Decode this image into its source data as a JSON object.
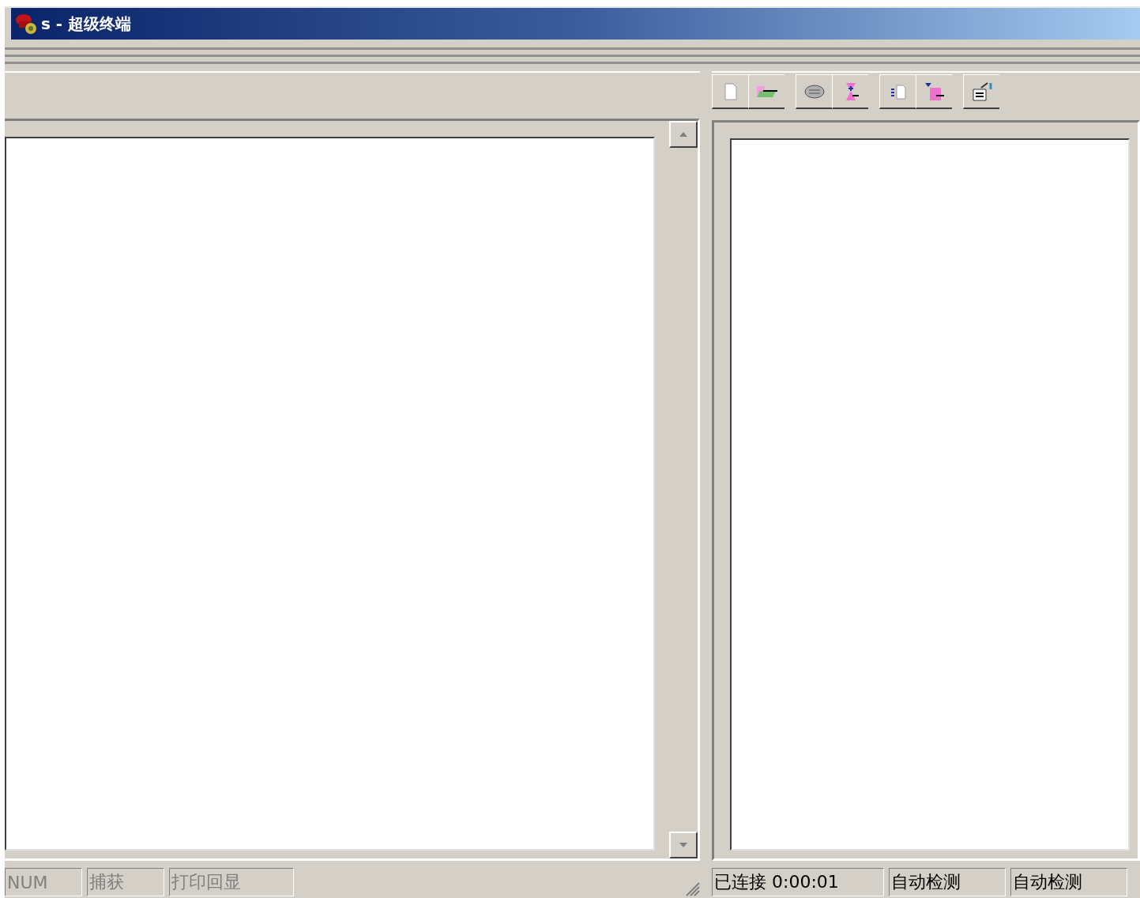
{
  "window": {
    "title": "s - 超级终端"
  },
  "left_status_bar": [
    {
      "text": "NUM",
      "disabled": true
    },
    {
      "text": "捕获",
      "disabled": true
    },
    {
      "text": "打印回显",
      "disabled": true
    }
  ],
  "right_status_bar": [
    {
      "text": "已连接 0:00:01",
      "disabled": false
    },
    {
      "text": "自动检测",
      "disabled": false
    },
    {
      "text": "自动检测",
      "disabled": false
    }
  ]
}
